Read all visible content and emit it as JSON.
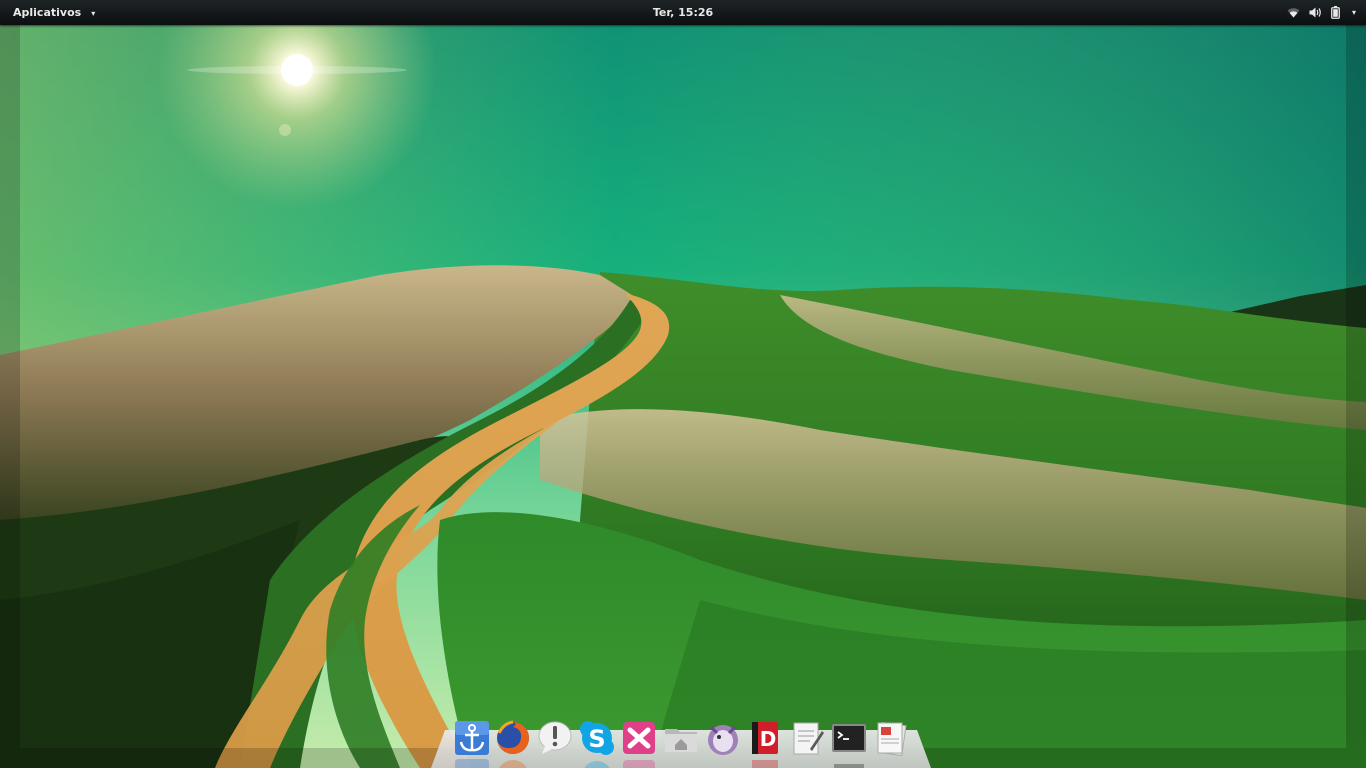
{
  "top_bar": {
    "applications_label": "Aplicativos",
    "applications_arrow": "▾",
    "clock": "Ter, 15:26",
    "status_icons": [
      "wifi-icon",
      "volume-icon",
      "battery-icon"
    ],
    "status_menu_arrow": "▾"
  },
  "wallpaper": {
    "description_icon": "green-hills-dirt-road-wallpaper",
    "sky_color": "#1aa87a",
    "horizon_color": "#a8e4a0"
  },
  "dock": {
    "items": [
      {
        "name": "docky-anchor-icon",
        "color": "#3a7bd5"
      },
      {
        "name": "firefox-icon",
        "color": "#e8621c"
      },
      {
        "name": "notification-exclamation-icon",
        "color": "#f2f2f2"
      },
      {
        "name": "skype-icon",
        "color": "#12a5e6"
      },
      {
        "name": "crossover-icon",
        "color": "#e0408a"
      },
      {
        "name": "home-folder-icon",
        "color": "#d8d8d8"
      },
      {
        "name": "pidgin-icon",
        "color": "#a080b8"
      },
      {
        "name": "dash-app-icon",
        "color": "#d01f2a"
      },
      {
        "name": "text-editor-icon",
        "color": "#e9e9e9"
      },
      {
        "name": "terminal-icon",
        "color": "#222222"
      },
      {
        "name": "document-viewer-icon",
        "color": "#f5f5f5"
      }
    ]
  }
}
